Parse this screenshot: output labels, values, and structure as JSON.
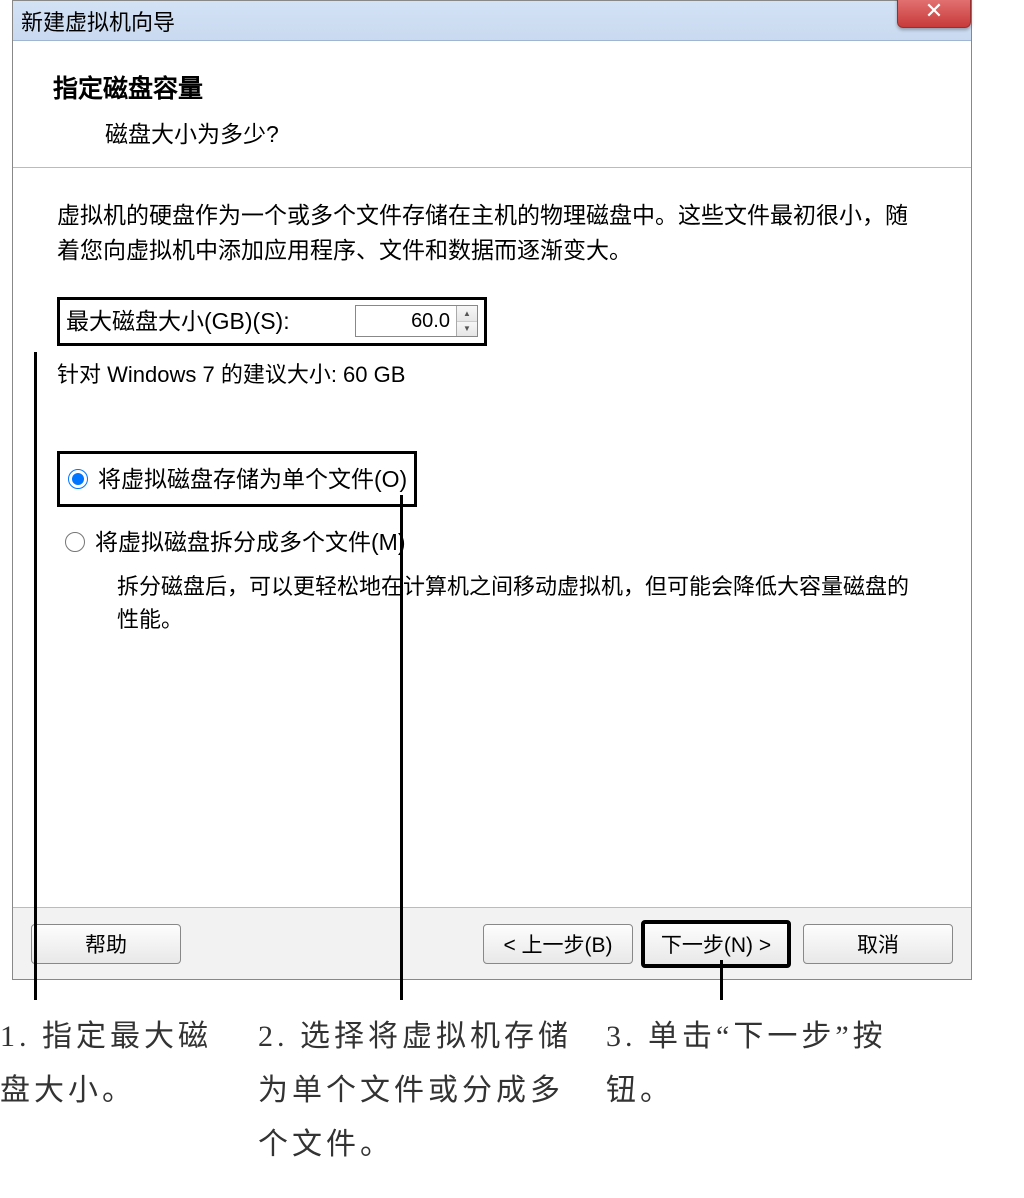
{
  "window": {
    "title": "新建虚拟机向导",
    "close_glyph": "✕"
  },
  "header": {
    "title": "指定磁盘容量",
    "subtitle": "磁盘大小为多少?"
  },
  "body": {
    "description": "虚拟机的硬盘作为一个或多个文件存储在主机的物理磁盘中。这些文件最初很小，随着您向虚拟机中添加应用程序、文件和数据而逐渐变大。",
    "disk_size_label": "最大磁盘大小(GB)(S):",
    "disk_size_value": "60.0",
    "recommend_text": "针对 Windows 7 的建议大小: 60 GB",
    "radio_single_label": "将虚拟磁盘存储为单个文件(O)",
    "radio_split_label": "将虚拟磁盘拆分成多个文件(M)",
    "split_desc": "拆分磁盘后，可以更轻松地在计算机之间移动虚拟机，但可能会降低大容量磁盘的性能。"
  },
  "buttons": {
    "help": "帮助",
    "back": "< 上一步(B)",
    "next": "下一步(N) >",
    "cancel": "取消"
  },
  "callouts": {
    "c1": "1. 指定最大磁盘大小。",
    "c2": "2. 选择将虚拟机存储为单个文件或分成多个文件。",
    "c3": "3. 单击“下一步”按钮。"
  }
}
